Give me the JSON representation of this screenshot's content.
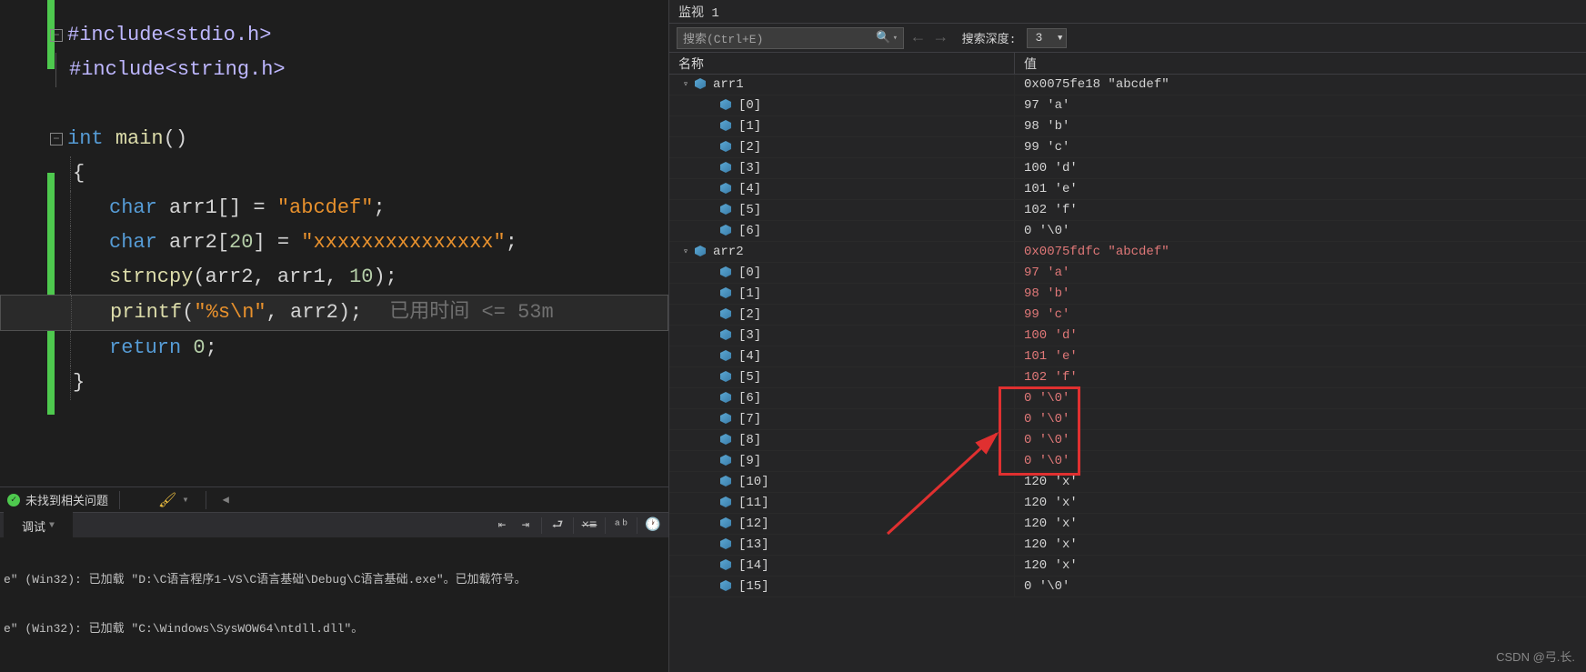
{
  "code": {
    "lines": [
      {
        "type": "pp",
        "text": "#include<stdio.h>"
      },
      {
        "type": "pp",
        "text": "#include<string.h>"
      },
      {
        "type": "blank"
      },
      {
        "type": "funcdef",
        "kw": "int",
        "name": "main",
        "rest": "()"
      },
      {
        "type": "brace",
        "text": "{"
      },
      {
        "type": "decl",
        "kw": "char",
        "id": "arr1[]",
        "eq": " = ",
        "str": "\"abcdef\"",
        "end": ";"
      },
      {
        "type": "decl",
        "kw": "char",
        "id": "arr2[",
        "num": "20",
        "id2": "]",
        "eq": " = ",
        "str": "\"xxxxxxxxxxxxxxx\"",
        "end": ";"
      },
      {
        "type": "call",
        "fn": "strncpy",
        "args_plain": "(arr2, arr1, ",
        "num": "10",
        "end": ");"
      },
      {
        "type": "printf",
        "fn": "printf",
        "open": "(",
        "str": "\"%s\\n\"",
        "rest": ", arr2);",
        "hint": "已用时间 <= 53m"
      },
      {
        "type": "ret",
        "kw": "return",
        "num": " 0",
        "end": ";"
      },
      {
        "type": "brace",
        "text": "}"
      }
    ]
  },
  "status": {
    "no_issues": "未找到相关问题"
  },
  "debug_panel": {
    "tab": "调试"
  },
  "output": {
    "line1": "e\" (Win32): 已加载 \"D:\\C语言程序1-VS\\C语言基础\\Debug\\C语言基础.exe\"。已加载符号。",
    "line2": "e\" (Win32): 已加载 \"C:\\Windows\\SysWOW64\\ntdll.dll\"。"
  },
  "watch": {
    "title": "监视 1",
    "search_placeholder": "搜索(Ctrl+E)",
    "depth_label": "搜索深度:",
    "depth_value": "3",
    "col_name": "名称",
    "col_value": "值",
    "rows": [
      {
        "indent": 0,
        "expand": "▿",
        "name": "arr1",
        "value": "0x0075fe18 \"abcdef\"",
        "changed": false
      },
      {
        "indent": 1,
        "name": "[0]",
        "value": "97 'a'",
        "changed": false
      },
      {
        "indent": 1,
        "name": "[1]",
        "value": "98 'b'",
        "changed": false
      },
      {
        "indent": 1,
        "name": "[2]",
        "value": "99 'c'",
        "changed": false
      },
      {
        "indent": 1,
        "name": "[3]",
        "value": "100 'd'",
        "changed": false
      },
      {
        "indent": 1,
        "name": "[4]",
        "value": "101 'e'",
        "changed": false
      },
      {
        "indent": 1,
        "name": "[5]",
        "value": "102 'f'",
        "changed": false
      },
      {
        "indent": 1,
        "name": "[6]",
        "value": "0 '\\0'",
        "changed": false
      },
      {
        "indent": 0,
        "expand": "▿",
        "name": "arr2",
        "value": "0x0075fdfc \"abcdef\"",
        "changed": true
      },
      {
        "indent": 1,
        "name": "[0]",
        "value": "97 'a'",
        "changed": true
      },
      {
        "indent": 1,
        "name": "[1]",
        "value": "98 'b'",
        "changed": true
      },
      {
        "indent": 1,
        "name": "[2]",
        "value": "99 'c'",
        "changed": true
      },
      {
        "indent": 1,
        "name": "[3]",
        "value": "100 'd'",
        "changed": true
      },
      {
        "indent": 1,
        "name": "[4]",
        "value": "101 'e'",
        "changed": true
      },
      {
        "indent": 1,
        "name": "[5]",
        "value": "102 'f'",
        "changed": true
      },
      {
        "indent": 1,
        "name": "[6]",
        "value": "0 '\\0'",
        "changed": true
      },
      {
        "indent": 1,
        "name": "[7]",
        "value": "0 '\\0'",
        "changed": true
      },
      {
        "indent": 1,
        "name": "[8]",
        "value": "0 '\\0'",
        "changed": true
      },
      {
        "indent": 1,
        "name": "[9]",
        "value": "0 '\\0'",
        "changed": true
      },
      {
        "indent": 1,
        "name": "[10]",
        "value": "120 'x'",
        "changed": false
      },
      {
        "indent": 1,
        "name": "[11]",
        "value": "120 'x'",
        "changed": false
      },
      {
        "indent": 1,
        "name": "[12]",
        "value": "120 'x'",
        "changed": false
      },
      {
        "indent": 1,
        "name": "[13]",
        "value": "120 'x'",
        "changed": false
      },
      {
        "indent": 1,
        "name": "[14]",
        "value": "120 'x'",
        "changed": false
      },
      {
        "indent": 1,
        "name": "[15]",
        "value": "0 '\\0'",
        "changed": false
      }
    ]
  },
  "watermark": "CSDN @弓.长."
}
